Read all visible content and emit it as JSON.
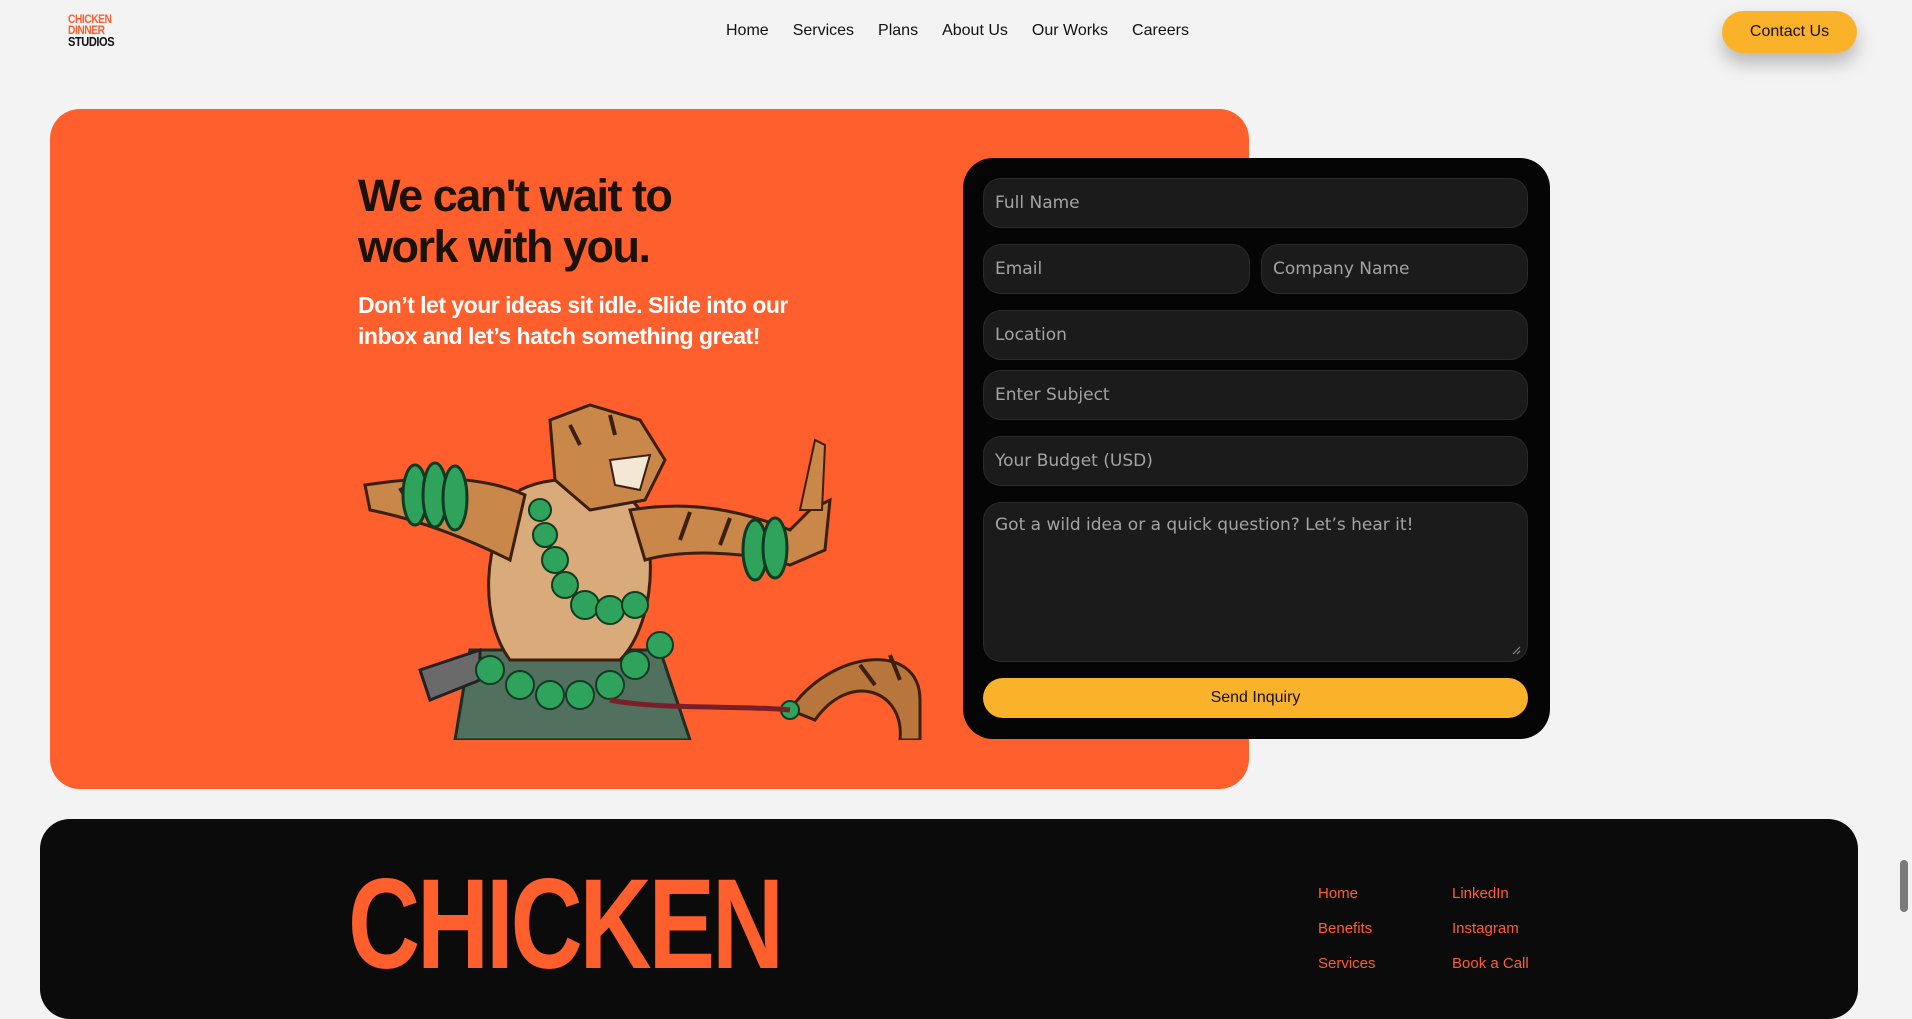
{
  "header": {
    "logo": {
      "line1": "CHICKEN",
      "line2": "DINNER",
      "line3": "STUDIOS"
    },
    "nav": [
      "Home",
      "Services",
      "Plans",
      "About Us",
      "Our Works",
      "Careers"
    ],
    "contact_label": "Contact Us"
  },
  "hero": {
    "headline": "We can't wait to work with you.",
    "subtext": "Don’t let your ideas sit idle. Slide into our inbox and let’s hatch something great!",
    "illustration": "tiger-warrior-illustration"
  },
  "form": {
    "full_name": "Full Name",
    "email": "Email",
    "company": "Company Name",
    "location": "Location",
    "subject": "Enter Subject",
    "budget": "Your Budget (USD)",
    "message": "Got a wild idea or a quick question? Let’s hear it!",
    "submit_label": "Send Inquiry"
  },
  "footer": {
    "brand_word": "CHICKEN",
    "col1": [
      "Home",
      "Benefits",
      "Services"
    ],
    "col2": [
      "LinkedIn",
      "Instagram",
      "Book a Call"
    ]
  },
  "colors": {
    "orange": "#ff5e2d",
    "yellow": "#fbb22b",
    "dark": "#050505"
  }
}
